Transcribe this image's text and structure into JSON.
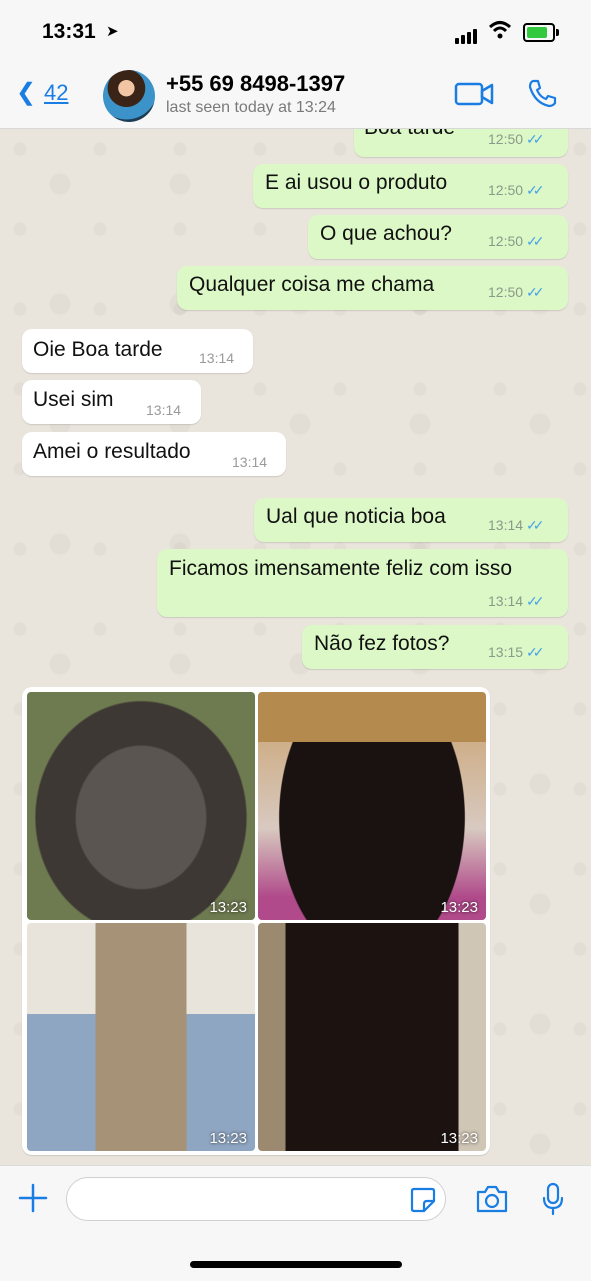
{
  "status_bar": {
    "time": "13:31"
  },
  "header": {
    "back_count": "42",
    "contact_name": "+55 69 8498-1397",
    "last_seen": "last seen today at 13:24"
  },
  "messages": [
    {
      "dir": "out",
      "text": "Boa tarde",
      "time": "12:50"
    },
    {
      "dir": "out",
      "text": "E ai usou o produto",
      "time": "12:50"
    },
    {
      "dir": "out",
      "text": "O que achou?",
      "time": "12:50"
    },
    {
      "dir": "out",
      "text": "Qualquer coisa me chama",
      "time": "12:50"
    },
    {
      "dir": "in",
      "text": "Oie Boa tarde",
      "time": "13:14"
    },
    {
      "dir": "in",
      "text": "Usei sim",
      "time": "13:14"
    },
    {
      "dir": "in",
      "text": "Amei o resultado",
      "time": "13:14"
    },
    {
      "dir": "out",
      "text": "Ual que noticia boa",
      "time": "13:14"
    },
    {
      "dir": "out",
      "text": "Ficamos imensamente feliz com isso",
      "time": "13:14"
    },
    {
      "dir": "out",
      "text": "Não fez fotos?",
      "time": "13:15"
    }
  ],
  "photos": [
    {
      "time": "13:23"
    },
    {
      "time": "13:23"
    },
    {
      "time": "13:23"
    },
    {
      "time": "13:23"
    }
  ],
  "colors": {
    "accent": "#1a7de3",
    "outgoing_bubble": "#dcf8c6",
    "incoming_bubble": "#ffffff",
    "read_tick": "#4aa3e8"
  }
}
